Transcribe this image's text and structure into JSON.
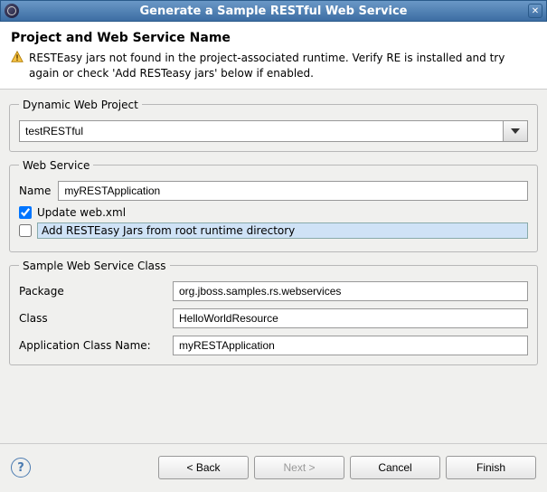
{
  "window": {
    "title": "Generate a Sample RESTful Web Service"
  },
  "header": {
    "title": "Project and Web Service Name",
    "warning": "RESTEasy jars not found in the project-associated runtime. Verify RE is installed and try again or check 'Add RESTeasy jars' below if enabled."
  },
  "project": {
    "legend": "Dynamic Web Project",
    "value": "testRESTful"
  },
  "webservice": {
    "legend": "Web Service",
    "name_label": "Name",
    "name_value": "myRESTApplication",
    "update_label": "Update web.xml",
    "update_checked": true,
    "addjars_label": "Add RESTEasy Jars from root runtime directory",
    "addjars_checked": false
  },
  "sample": {
    "legend": "Sample Web Service Class",
    "package_label": "Package",
    "package_value": "org.jboss.samples.rs.webservices",
    "class_label": "Class",
    "class_value": "HelloWorldResource",
    "appclass_label": "Application Class Name:",
    "appclass_value": "myRESTApplication"
  },
  "buttons": {
    "back": "< Back",
    "next": "Next >",
    "cancel": "Cancel",
    "finish": "Finish"
  }
}
